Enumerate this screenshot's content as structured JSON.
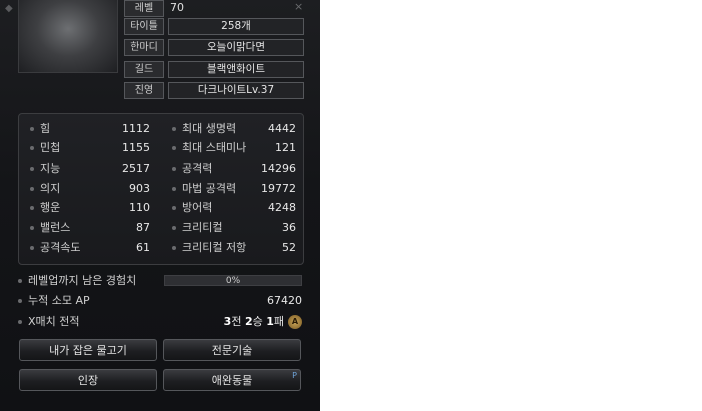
{
  "profile": {
    "level_label": "레벨",
    "level_value": "70",
    "rows": [
      {
        "label": "타이틀",
        "value": "258개"
      },
      {
        "label": "한마디",
        "value": "오늘이맑다면"
      },
      {
        "label": "길드",
        "value": "블랙앤화이트"
      },
      {
        "label": "진영",
        "value": "다크나이트Lv.37"
      }
    ]
  },
  "stats": [
    {
      "label": "힘",
      "value": "1112"
    },
    {
      "label": "민첩",
      "value": "1155"
    },
    {
      "label": "지능",
      "value": "2517"
    },
    {
      "label": "의지",
      "value": "903"
    },
    {
      "label": "행운",
      "value": "110"
    },
    {
      "label": "밸런스",
      "value": "87"
    },
    {
      "label": "공격속도",
      "value": "61"
    }
  ],
  "stats2": [
    {
      "label": "최대 생명력",
      "value": "4442"
    },
    {
      "label": "최대 스태미나",
      "value": "121"
    },
    {
      "label": "공격력",
      "value": "14296"
    },
    {
      "label": "마법 공격력",
      "value": "19772"
    },
    {
      "label": "방어력",
      "value": "4248"
    },
    {
      "label": "크리티컬",
      "value": "36"
    },
    {
      "label": "크리티컬 저항",
      "value": "52"
    }
  ],
  "exp": {
    "label": "레벨업까지 남은 경험치",
    "percent_text": "0%",
    "fraction": 0
  },
  "ap": {
    "label": "누적 소모 AP",
    "value": "67420"
  },
  "xmatch": {
    "label": "X매치 전적",
    "draws": "3",
    "draws_unit": "전",
    "wins": "2",
    "wins_unit": "승",
    "losses": "1",
    "losses_unit": "패",
    "medal": "A"
  },
  "buttons": {
    "fish": "내가 잡은 물고기",
    "skills": "전문기술",
    "stamp": "인장",
    "pets": "애완동물",
    "pets_tag": "P"
  }
}
